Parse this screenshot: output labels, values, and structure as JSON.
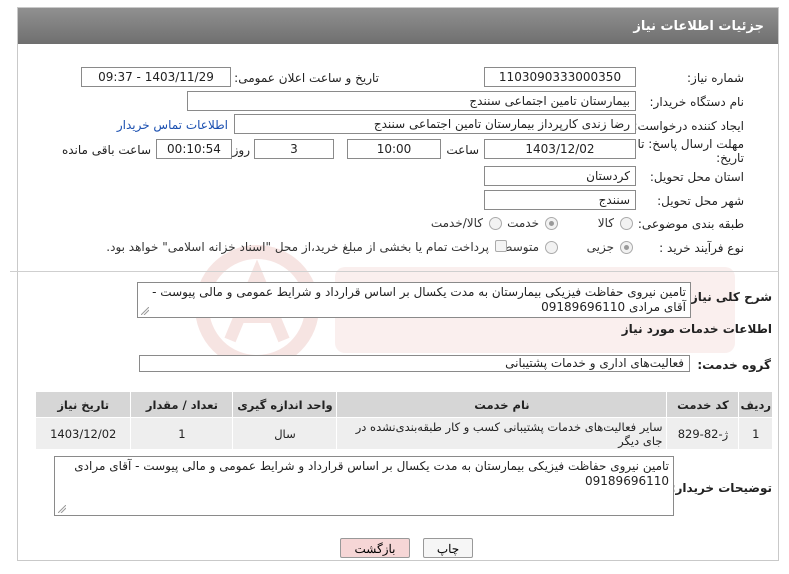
{
  "header": {
    "title": "جزئیات اطلاعات نیاز"
  },
  "form": {
    "need_number": {
      "label": "شماره نیاز:",
      "value": "1103090333000350"
    },
    "announce_datetime": {
      "label": "تاریخ و ساعت اعلان عمومی:",
      "value": "1403/11/29 - 09:37"
    },
    "buyer_org": {
      "label": "نام دستگاه خریدار:",
      "value": "بیمارستان تامین اجتماعی سنندج"
    },
    "requester": {
      "label": "ایجاد کننده درخواست:",
      "value": "رضا زندی کارپرداز بیمارستان تامین اجتماعی سنندج"
    },
    "contact_link": "اطلاعات تماس خریدار",
    "deadline": {
      "label_line1": "مهلت ارسال پاسخ: تا",
      "label_line2": "تاریخ:",
      "date": "1403/12/02",
      "time_label": "ساعت",
      "time": "10:00",
      "days": "3",
      "days_label": "روز و",
      "remaining": "00:10:54",
      "remaining_label": "ساعت باقی مانده"
    },
    "province": {
      "label": "استان محل تحویل:",
      "value": "کردستان"
    },
    "city": {
      "label": "شهر محل تحویل:",
      "value": "سنندج"
    },
    "category": {
      "label": "طبقه بندی موضوعی:",
      "options": [
        "کالا",
        "خدمت",
        "کالا/خدمت"
      ],
      "selected": "خدمت"
    },
    "purchase_type": {
      "label": "نوع فرآیند خرید :",
      "options": [
        "جزیی",
        "متوسط"
      ],
      "selected": "جزیی",
      "treasury_note": "پرداخت تمام یا بخشی از مبلغ خرید،از محل \"اسناد خزانه اسلامی\" خواهد بود."
    }
  },
  "summary": {
    "label": "شرح کلی نیاز:",
    "text": "تامین نیروی حفاظت فیزیکی بیمارستان به مدت یکسال بر اساس قرارداد و شرایط عمومی و مالی پیوست - آقای مرادی 09189696110"
  },
  "services": {
    "section_title": "اطلاعات خدمات مورد نیاز",
    "group_label": "گروه خدمت:",
    "group_value": "فعالیت‌های اداری و خدمات پشتیبانی",
    "columns": [
      "ردیف",
      "کد خدمت",
      "نام خدمت",
      "واحد اندازه گیری",
      "تعداد / مقدار",
      "تاریخ نیاز"
    ],
    "rows": [
      {
        "row": "1",
        "code": "ژ-82-829",
        "name": "سایر فعالیت‌های خدمات پشتیبانی کسب و کار طبقه‌بندی‌نشده در جای دیگر",
        "unit": "سال",
        "qty": "1",
        "date": "1403/12/02"
      }
    ]
  },
  "buyer_notes": {
    "label": "توضیحات خریدار:",
    "text": "تامین نیروی حفاظت فیزیکی بیمارستان به مدت یکسال بر اساس قرارداد و شرایط عمومی و مالی پیوست - آقای مرادی 09189696110"
  },
  "buttons": {
    "print": "چاپ",
    "back": "بازگشت"
  },
  "colors": {
    "header_bg": "#808080",
    "link": "#1a4fb0",
    "back_btn_bg": "#f6d6d6",
    "watermark": "#c0392b"
  }
}
